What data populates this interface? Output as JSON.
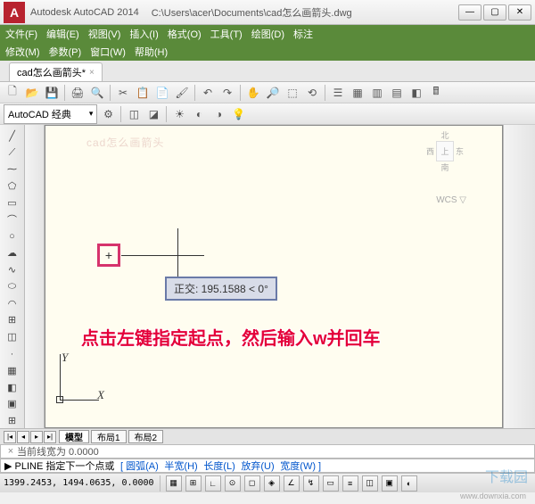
{
  "titlebar": {
    "app": "Autodesk AutoCAD 2014",
    "path": "C:\\Users\\acer\\Documents\\cad怎么画箭头.dwg",
    "logo_letter": "A"
  },
  "menu1": [
    "文件(F)",
    "编辑(E)",
    "视图(V)",
    "插入(I)",
    "格式(O)",
    "工具(T)",
    "绘图(D)",
    "标注"
  ],
  "menu2": [
    "修改(M)",
    "参数(P)",
    "窗口(W)",
    "帮助(H)"
  ],
  "file_tab": {
    "label": "cad怎么画箭头*",
    "close": "×"
  },
  "workspace": {
    "label": "AutoCAD 经典"
  },
  "tooltip": {
    "text": "正交: 195.1588  <  0°"
  },
  "start_marker": "+",
  "annotation": "点击左键指定起点，然后输入w并回车",
  "ucs": {
    "x": "X",
    "y": "Y"
  },
  "nav": {
    "n": "北",
    "w": "西",
    "top": "上",
    "e": "东",
    "s": "南",
    "wcs": "WCS ▽"
  },
  "layout_nav": [
    "|◂",
    "◂",
    "▸",
    "▸|"
  ],
  "layout_tabs": [
    "模型",
    "布局1",
    "布局2"
  ],
  "cmd_history": "当前线宽为  0.0000",
  "cmd_prompt": {
    "prefix": "▶ PLINE 指定下一个点或",
    "options": [
      "[ 圆弧(A)",
      "半宽(H)",
      "长度(L)",
      "放弃(U)",
      "宽度(W) ]"
    ]
  },
  "status": {
    "coords": "1399.2453, 1494.0635, 0.0000"
  },
  "watermark_canvas": "cad怎么画箭头",
  "watermark_logo": "下载园",
  "watermark_url": "www.downxia.com"
}
